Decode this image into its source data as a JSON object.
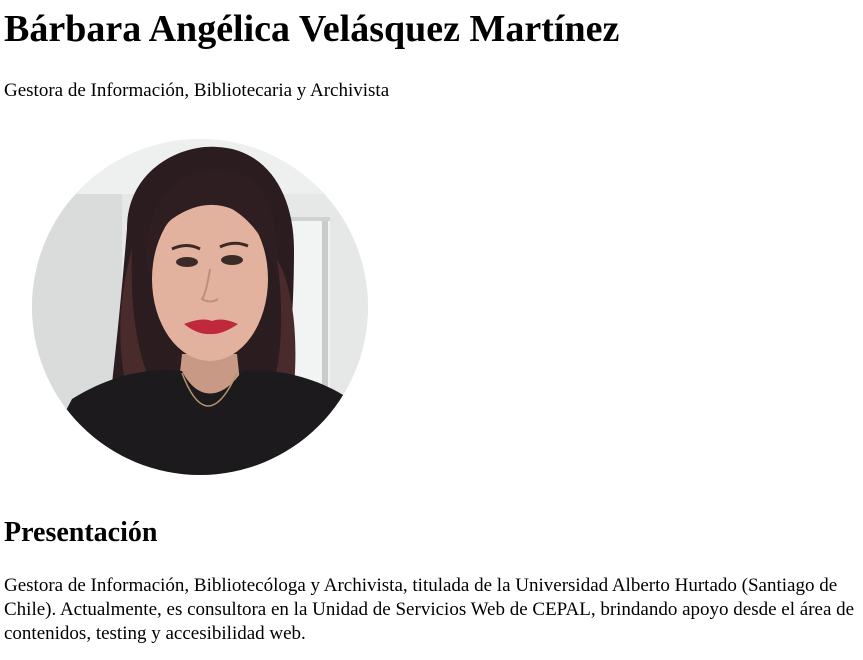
{
  "profile": {
    "name": "Bárbara Angélica Velásquez Martínez",
    "role": "Gestora de Información, Bibliotecaria y Archivista"
  },
  "about": {
    "heading": "Presentación",
    "text": "Gestora de Información, Bibliotecóloga y Archivista, titulada de la Universidad Alberto Hurtado (Santiago de Chile). Actualmente, es consultora en la Unidad de Servicios Web de CEPAL, brindando apoyo desde el área de contenidos, testing y accesibilidad web."
  }
}
